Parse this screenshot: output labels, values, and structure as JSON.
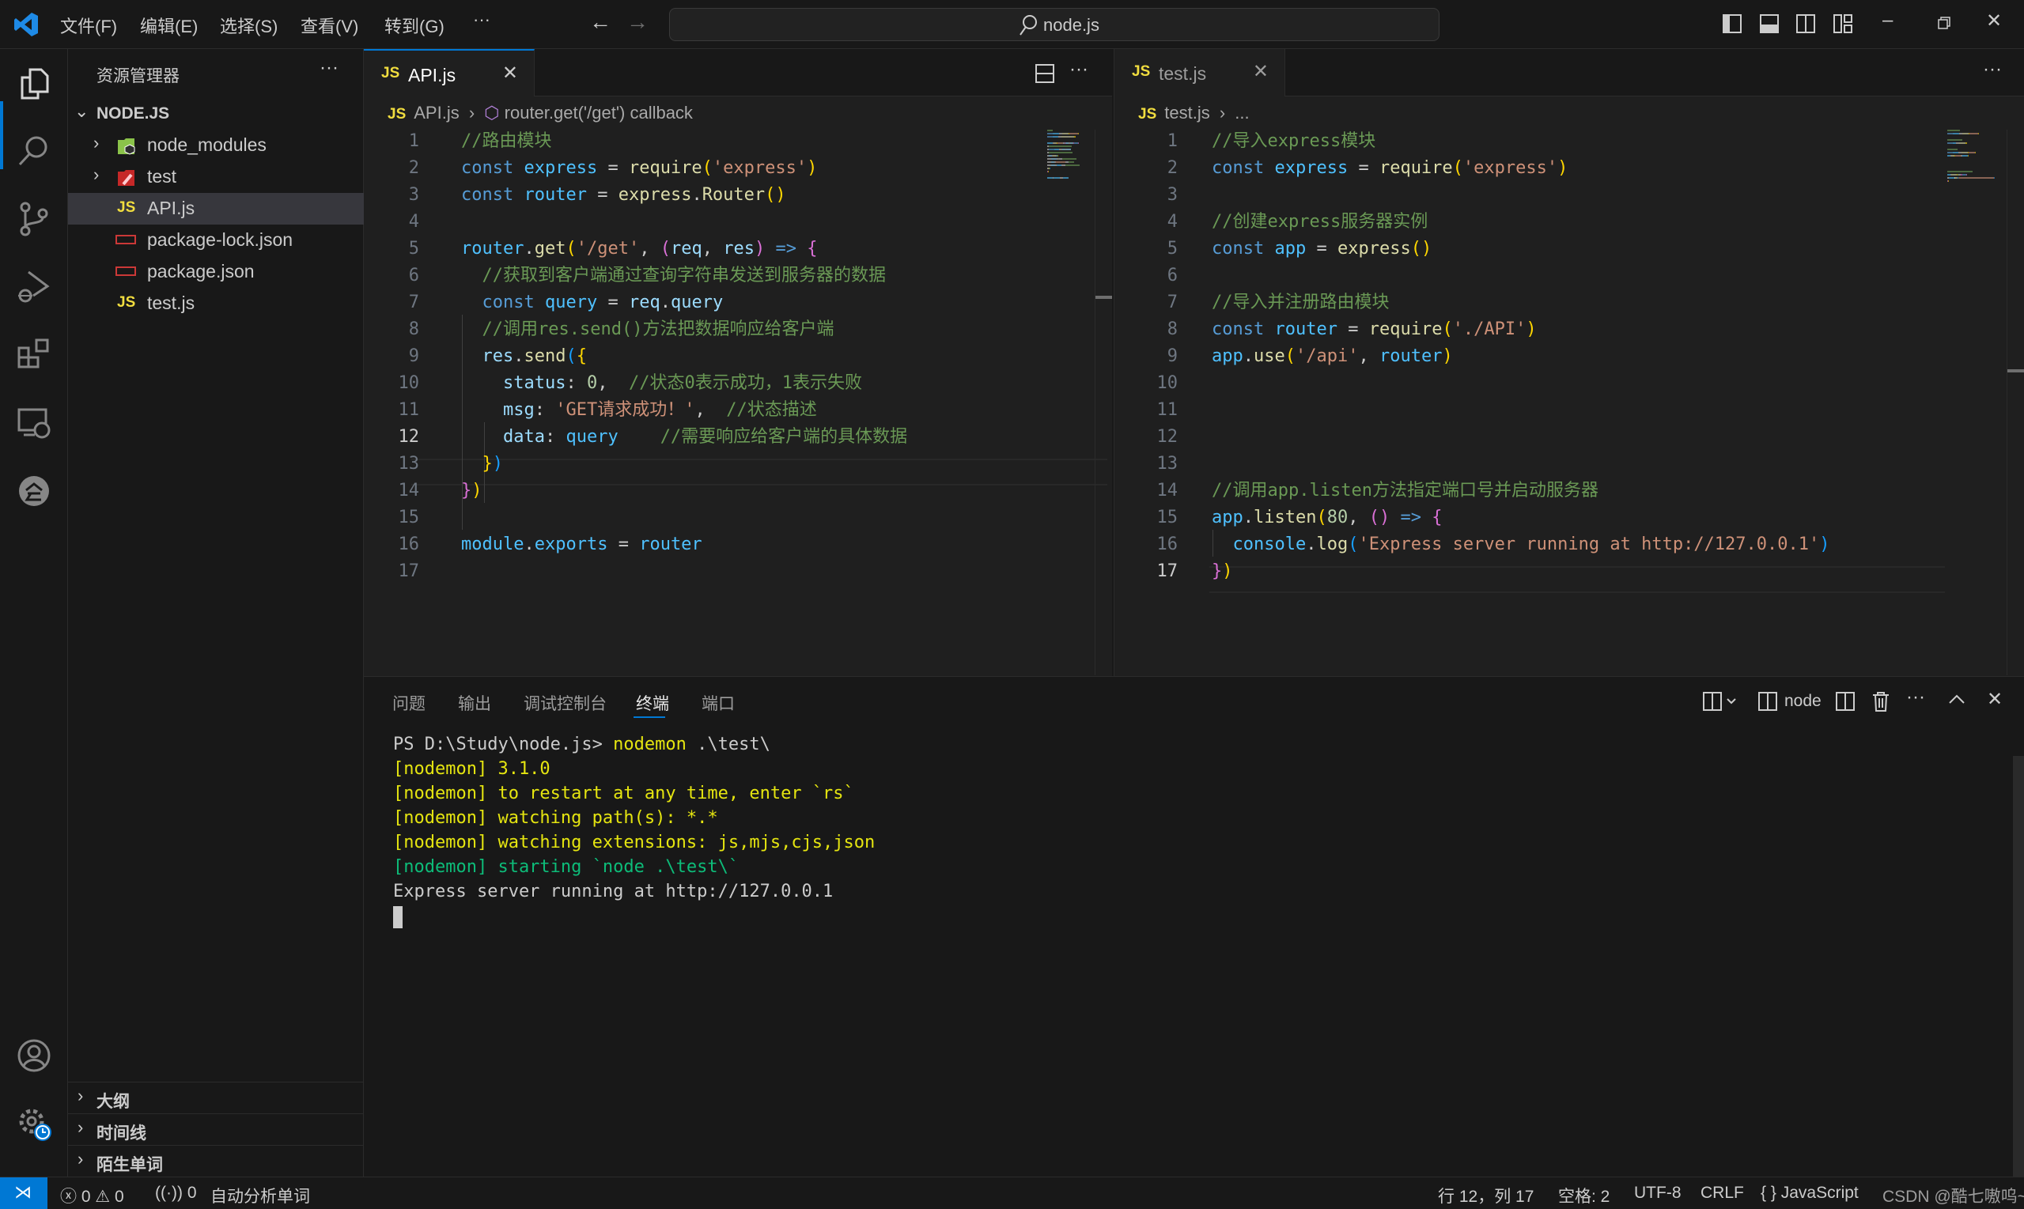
{
  "titlebar": {
    "menus": [
      "文件(F)",
      "编辑(E)",
      "选择(S)",
      "查看(V)",
      "转到(G)"
    ],
    "more_label": "···",
    "search_text": "node.js"
  },
  "sidebar": {
    "title": "资源管理器",
    "root": "NODE.JS",
    "items": [
      {
        "label": "node_modules",
        "type": "folder",
        "icon": "node-folder-icon"
      },
      {
        "label": "test",
        "type": "folder",
        "icon": "test-folder-icon"
      },
      {
        "label": "API.js",
        "type": "file",
        "icon": "js-file-icon",
        "selected": true
      },
      {
        "label": "package-lock.json",
        "type": "file",
        "icon": "npm-file-icon"
      },
      {
        "label": "package.json",
        "type": "file",
        "icon": "npm-file-icon"
      },
      {
        "label": "test.js",
        "type": "file",
        "icon": "js-file-icon"
      }
    ],
    "sections": [
      "大纲",
      "时间线",
      "陌生单词"
    ]
  },
  "editor_left": {
    "tab_label": "API.js",
    "tab_badge": "JS",
    "breadcrumb": {
      "file": "API.js",
      "symbol": "router.get('/get') callback"
    },
    "current_line": 12,
    "lines": [
      [
        [
          "c-com",
          "//路由模块"
        ]
      ],
      [
        [
          "c-kw",
          "const "
        ],
        [
          "c-var",
          "express"
        ],
        [
          "c-pun",
          " = "
        ],
        [
          "c-fn",
          "require"
        ],
        [
          "b1",
          "("
        ],
        [
          "c-str",
          "'express'"
        ],
        [
          "b1",
          ")"
        ]
      ],
      [
        [
          "c-kw",
          "const "
        ],
        [
          "c-var",
          "router"
        ],
        [
          "c-pun",
          " = "
        ],
        [
          "c-fn",
          "express"
        ],
        [
          "c-pun",
          "."
        ],
        [
          "c-fn",
          "Router"
        ],
        [
          "b1",
          "()"
        ]
      ],
      [],
      [
        [
          "c-var",
          "router"
        ],
        [
          "c-pun",
          "."
        ],
        [
          "c-fn",
          "get"
        ],
        [
          "b1",
          "("
        ],
        [
          "c-str",
          "'/get'"
        ],
        [
          "c-pun",
          ", "
        ],
        [
          "b2",
          "("
        ],
        [
          "c-prop",
          "req"
        ],
        [
          "c-pun",
          ", "
        ],
        [
          "c-prop",
          "res"
        ],
        [
          "b2",
          ")"
        ],
        [
          "c-kw",
          " => "
        ],
        [
          "b2",
          "{"
        ]
      ],
      [
        [
          "c-pun",
          "  "
        ],
        [
          "c-com",
          "//获取到客户端通过查询字符串发送到服务器的数据"
        ]
      ],
      [
        [
          "c-pun",
          "  "
        ],
        [
          "c-kw",
          "const "
        ],
        [
          "c-var",
          "query"
        ],
        [
          "c-pun",
          " = "
        ],
        [
          "c-prop",
          "req"
        ],
        [
          "c-pun",
          "."
        ],
        [
          "c-prop",
          "query"
        ]
      ],
      [
        [
          "c-pun",
          "  "
        ],
        [
          "c-com",
          "//调用res.send()方法把数据响应给客户端"
        ]
      ],
      [
        [
          "c-pun",
          "  "
        ],
        [
          "c-prop",
          "res"
        ],
        [
          "c-pun",
          "."
        ],
        [
          "c-fn",
          "send"
        ],
        [
          "b3",
          "("
        ],
        [
          "b1",
          "{"
        ]
      ],
      [
        [
          "c-pun",
          "    "
        ],
        [
          "c-prop",
          "status"
        ],
        [
          "c-pun",
          ": "
        ],
        [
          "c-num",
          "0"
        ],
        [
          "c-pun",
          ",  "
        ],
        [
          "c-com",
          "//状态0表示成功，1表示失败"
        ]
      ],
      [
        [
          "c-pun",
          "    "
        ],
        [
          "c-prop",
          "msg"
        ],
        [
          "c-pun",
          ": "
        ],
        [
          "c-str",
          "'GET请求成功！'"
        ],
        [
          "c-pun",
          ",  "
        ],
        [
          "c-com",
          "//状态描述"
        ]
      ],
      [
        [
          "c-pun",
          "    "
        ],
        [
          "c-prop",
          "data"
        ],
        [
          "c-pun",
          ": "
        ],
        [
          "c-var",
          "query"
        ],
        [
          "c-pun",
          "    "
        ],
        [
          "c-com",
          "//需要响应给客户端的具体数据"
        ]
      ],
      [
        [
          "c-pun",
          "  "
        ],
        [
          "b1",
          "}"
        ],
        [
          "b3",
          ")"
        ]
      ],
      [
        [
          "b2",
          "}"
        ],
        [
          "b1",
          ")"
        ]
      ],
      [],
      [
        [
          "c-var",
          "module"
        ],
        [
          "c-pun",
          "."
        ],
        [
          "c-var",
          "exports"
        ],
        [
          "c-pun",
          " = "
        ],
        [
          "c-var",
          "router"
        ]
      ],
      []
    ]
  },
  "editor_right": {
    "tab_label": "test.js",
    "tab_badge": "JS",
    "breadcrumb": {
      "file": "test.js",
      "symbol": "..."
    },
    "current_line": 17,
    "lines": [
      [
        [
          "c-com",
          "//导入express模块"
        ]
      ],
      [
        [
          "c-kw",
          "const "
        ],
        [
          "c-var",
          "express"
        ],
        [
          "c-pun",
          " = "
        ],
        [
          "c-fn",
          "require"
        ],
        [
          "b1",
          "("
        ],
        [
          "c-str",
          "'express'"
        ],
        [
          "b1",
          ")"
        ]
      ],
      [],
      [
        [
          "c-com",
          "//创建express服务器实例"
        ]
      ],
      [
        [
          "c-kw",
          "const "
        ],
        [
          "c-var",
          "app"
        ],
        [
          "c-pun",
          " = "
        ],
        [
          "c-fn",
          "express"
        ],
        [
          "b1",
          "()"
        ]
      ],
      [],
      [
        [
          "c-com",
          "//导入并注册路由模块"
        ]
      ],
      [
        [
          "c-kw",
          "const "
        ],
        [
          "c-var",
          "router"
        ],
        [
          "c-pun",
          " = "
        ],
        [
          "c-fn",
          "require"
        ],
        [
          "b1",
          "("
        ],
        [
          "c-str",
          "'./API'"
        ],
        [
          "b1",
          ")"
        ]
      ],
      [
        [
          "c-var",
          "app"
        ],
        [
          "c-pun",
          "."
        ],
        [
          "c-fn",
          "use"
        ],
        [
          "b1",
          "("
        ],
        [
          "c-str",
          "'/api'"
        ],
        [
          "c-pun",
          ", "
        ],
        [
          "c-var",
          "router"
        ],
        [
          "b1",
          ")"
        ]
      ],
      [],
      [],
      [],
      [],
      [
        [
          "c-com",
          "//调用app.listen方法指定端口号并启动服务器"
        ]
      ],
      [
        [
          "c-var",
          "app"
        ],
        [
          "c-pun",
          "."
        ],
        [
          "c-fn",
          "listen"
        ],
        [
          "b1",
          "("
        ],
        [
          "c-num",
          "80"
        ],
        [
          "c-pun",
          ", "
        ],
        [
          "b2",
          "()"
        ],
        [
          "c-kw",
          " => "
        ],
        [
          "b2",
          "{"
        ]
      ],
      [
        [
          "c-pun",
          "  "
        ],
        [
          "c-var",
          "console"
        ],
        [
          "c-pun",
          "."
        ],
        [
          "c-fn",
          "log"
        ],
        [
          "b3",
          "("
        ],
        [
          "c-str",
          "'Express server running at http://127.0.0.1'"
        ],
        [
          "b3",
          ")"
        ]
      ],
      [
        [
          "b2",
          "}"
        ],
        [
          "b1",
          ")"
        ]
      ]
    ]
  },
  "panel": {
    "tabs": [
      "问题",
      "输出",
      "调试控制台",
      "终端",
      "端口"
    ],
    "active_tab": "终端",
    "terminal_name": "node",
    "terminal_lines": [
      {
        "segments": [
          [
            "t-wht",
            "PS D:\\Study\\node.js> "
          ],
          [
            "t-yel",
            "nodemon"
          ],
          [
            "t-wht",
            " .\\test\\"
          ]
        ]
      },
      {
        "segments": [
          [
            "t-yel",
            "[nodemon] 3.1.0"
          ]
        ]
      },
      {
        "segments": [
          [
            "t-yel",
            "[nodemon] to restart at any time, enter `rs`"
          ]
        ]
      },
      {
        "segments": [
          [
            "t-yel",
            "[nodemon] watching path(s): *.*"
          ]
        ]
      },
      {
        "segments": [
          [
            "t-yel",
            "[nodemon] watching extensions: js,mjs,cjs,json"
          ]
        ]
      },
      {
        "segments": [
          [
            "t-grn",
            "[nodemon] starting `node .\\test\\`"
          ]
        ]
      },
      {
        "segments": [
          [
            "t-wht",
            "Express server running at http://127.0.0.1"
          ]
        ]
      }
    ]
  },
  "statusbar": {
    "errors": "0",
    "warnings": "0",
    "ports": "0",
    "analyze": "自动分析单词",
    "position": "行 12，列 17",
    "spaces": "空格: 2",
    "encoding": "UTF-8",
    "eol": "CRLF",
    "language": "JavaScript",
    "watermark": "CSDN @酷七嗷呜~"
  }
}
